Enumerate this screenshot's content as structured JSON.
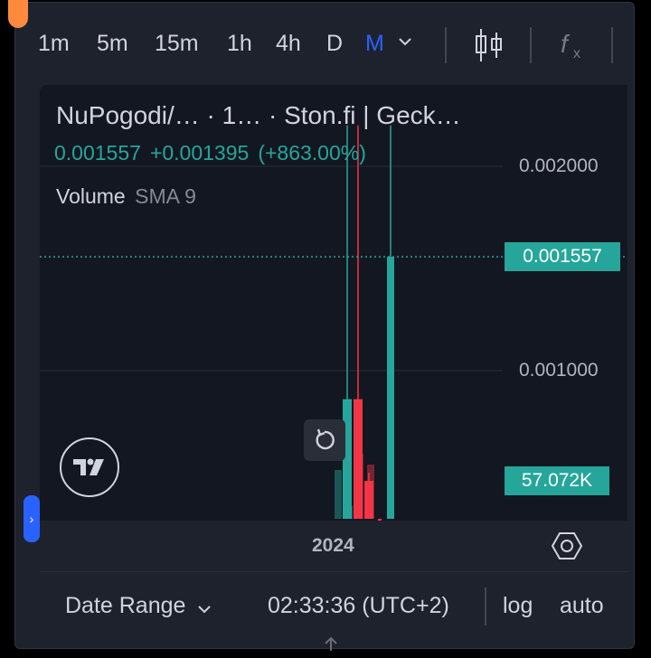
{
  "toolbar": {
    "timeframes": [
      {
        "label": "1m",
        "active": false
      },
      {
        "label": "5m",
        "active": false
      },
      {
        "label": "15m",
        "active": false
      },
      {
        "label": "1h",
        "active": false
      },
      {
        "label": "4h",
        "active": false
      },
      {
        "label": "D",
        "active": false
      },
      {
        "label": "M",
        "active": true
      }
    ],
    "dropdown_icon": "chevron-down-icon",
    "chart_type_icon": "candles-icon",
    "indicators_icon": "fx-icon"
  },
  "legend": {
    "title": "NuPogodi/…  · 1… · Ston.fi | Geck…",
    "last": "0.001557",
    "change": "+0.001395",
    "change_pct": "(+863.00%)",
    "volume_name": "Volume",
    "volume_sma": "SMA 9"
  },
  "price_scale": {
    "labels": [
      "0.002000",
      "0.001000"
    ],
    "current_price": "0.001557",
    "current_volume": "57.072K"
  },
  "time_axis": {
    "label": "2024"
  },
  "bottom_bar": {
    "date_range": "Date Range",
    "time": "02:33:36 (UTC+2)",
    "log": "log",
    "auto": "auto"
  },
  "colors": {
    "up": "#26a69a",
    "down": "#f23645",
    "accent": "#2962ff",
    "background": "#131722"
  },
  "chart_data": {
    "type": "candlestick",
    "title": "NuPogodi/…  · 1… · Ston.fi | Geck…",
    "ylim": [
      0,
      0.0022
    ],
    "y_ticks": [
      0.001,
      0.002
    ],
    "x_label": "2024",
    "candles": [
      {
        "open": 4e-05,
        "close": 0.00086,
        "high": 0.0022,
        "low": 1e-05,
        "dir": "up"
      },
      {
        "open": 0.00086,
        "close": 2e-05,
        "high": 0.0022,
        "low": 1e-05,
        "dir": "down"
      },
      {
        "open": 2e-05,
        "close": 0.00046,
        "high": 0.0005,
        "low": 1e-05,
        "dir": "down"
      },
      {
        "open": 1e-05,
        "close": 2e-05,
        "high": 3e-05,
        "low": 1e-05,
        "dir": "down"
      },
      {
        "open": 1e-05,
        "close": 0.001557,
        "high": 0.0022,
        "low": 1e-05,
        "dir": "up"
      }
    ],
    "last_price": 0.001557,
    "volume_last": "57.072K"
  }
}
